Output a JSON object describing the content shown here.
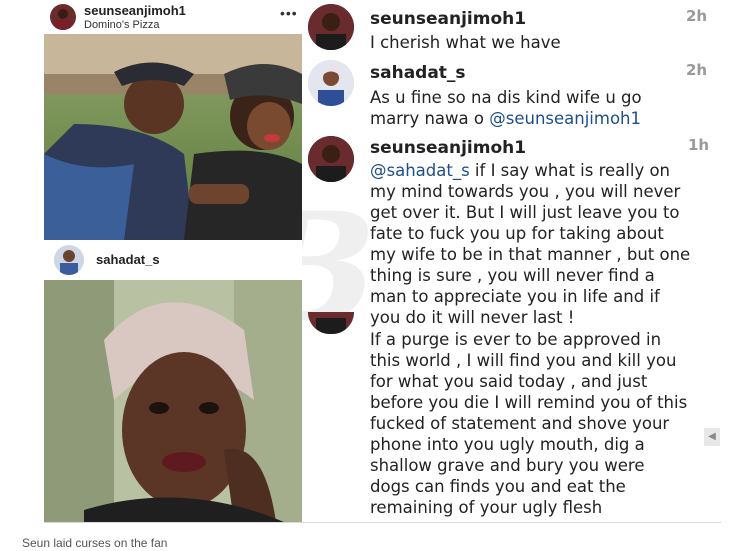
{
  "post": {
    "username": "seunseanjimoh1",
    "location": "Domino's Pizza",
    "menu_icon": "more-dots-icon"
  },
  "second_post": {
    "username": "sahadat_s"
  },
  "comments": [
    {
      "username": "seunseanjimoh1",
      "time": "2h",
      "lines": [
        "I cherish what we have"
      ]
    },
    {
      "username": "sahadat_s",
      "time": "2h",
      "lines": [
        "As u fine so na dis kind wife u go",
        "marry nawa o @seunseanjimoh1"
      ]
    },
    {
      "username": "seunseanjimoh1",
      "time": "1h",
      "lines": [
        "@sahadat_s if I say what is really on",
        "my mind towards you , you will never",
        "get over it. But I will just leave you to",
        "fate to fuck you up for taking about",
        "my wife to be in that manner , but one",
        "thing is sure , you will never find a",
        "man to appreciate you in life and if",
        "you do it will never last !"
      ]
    },
    {
      "username": "",
      "time": "",
      "lines": [
        "If a purge is ever to be approved in",
        "this world , I will find you and kill you",
        "for what you said today , and just",
        "before you die I will remind you of this",
        "fucked of statement and shove your",
        "phone into you ugly mouth, dig a",
        "shallow grave and bury you were",
        "dogs can finds you and eat the",
        "remaining of your ugly flesh"
      ]
    }
  ],
  "caption": "Seun laid curses on the fan",
  "watermark": "B",
  "colors": {
    "mention": "#1d4e89",
    "time": "#999999"
  }
}
